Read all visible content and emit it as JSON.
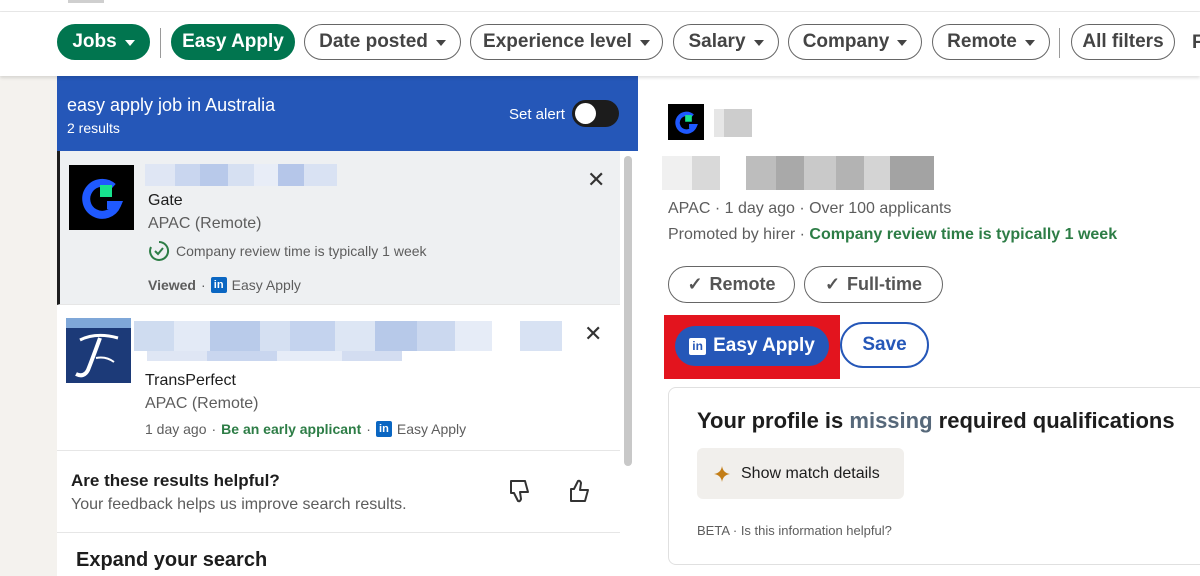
{
  "filters": [
    {
      "label": "Jobs",
      "has_caret": true,
      "active": true
    },
    {
      "label": "Easy Apply",
      "has_caret": false,
      "active": true
    },
    {
      "label": "Date posted",
      "has_caret": true,
      "active": false
    },
    {
      "label": "Experience level",
      "has_caret": true,
      "active": false
    },
    {
      "label": "Salary",
      "has_caret": true,
      "active": false
    },
    {
      "label": "Company",
      "has_caret": true,
      "active": false
    },
    {
      "label": "Remote",
      "has_caret": true,
      "active": false
    },
    {
      "label": "All filters",
      "has_caret": false,
      "active": false
    }
  ],
  "filters_overflow_letter": "F",
  "list_header": {
    "title": "easy apply job in Australia",
    "count": "2 results",
    "set_alert_label": "Set alert"
  },
  "jobs": [
    {
      "company": "Gate",
      "location": "APAC (Remote)",
      "review_note": "Company review time is typically 1 week",
      "status": "Viewed",
      "separator": "·",
      "easy_apply_label": "Easy Apply",
      "dismiss_glyph": "✕"
    },
    {
      "company": "TransPerfect",
      "location": "APAC (Remote)",
      "posted": "1 day ago",
      "separator": "·",
      "early_note": "Be an early applicant",
      "easy_apply_label": "Easy Apply",
      "dismiss_glyph": "✕"
    }
  ],
  "linkedin_badge": "in",
  "feedback": {
    "title": "Are these results helpful?",
    "subtitle": "Your feedback helps us improve search results."
  },
  "expand_title": "Expand your search",
  "detail": {
    "meta_line": "APAC · 1 day ago · Over 100 applicants",
    "promoted_prefix": "Promoted by hirer · ",
    "promoted_note": "Company review time is typically 1 week",
    "tags": [
      "Remote",
      "Full-time"
    ],
    "check_glyph": "✓",
    "easy_apply_label": "Easy Apply",
    "save_label": "Save",
    "qualifications": {
      "title_part1": "Your profile is ",
      "title_part2": "missing",
      "title_part3": " required qualifications",
      "match_button": "Show match details",
      "beta_text": "BETA · Is this information helpful?"
    }
  },
  "colors": {
    "brand_blue": "#2557b8",
    "linkedin_blue": "#0a66c2",
    "active_filter_green": "#01754f",
    "success_green": "#2d7d46",
    "highlight_red": "#e3141e"
  }
}
